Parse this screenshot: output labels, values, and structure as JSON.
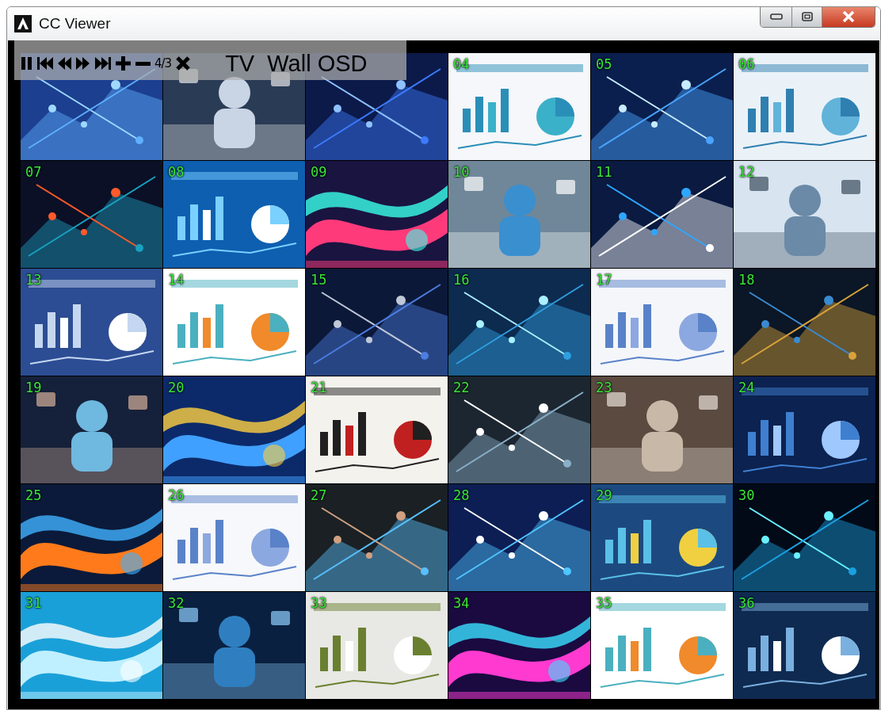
{
  "window": {
    "title": "CC Viewer"
  },
  "osd": {
    "controls": [
      {
        "kind": "pause"
      },
      {
        "kind": "first"
      },
      {
        "kind": "rewind"
      },
      {
        "kind": "forward"
      },
      {
        "kind": "last"
      },
      {
        "kind": "plus"
      },
      {
        "kind": "minus"
      },
      {
        "kind": "ratio",
        "text": "4/3"
      },
      {
        "kind": "close"
      }
    ],
    "title": "TV  Wall OSD"
  },
  "tiles": [
    {
      "kind": "picture"
    },
    {
      "kind": "picture"
    },
    {
      "kind": "picture"
    },
    {
      "kind": "picture",
      "label": "04"
    },
    {
      "kind": "picture",
      "label": "05"
    },
    {
      "kind": "picture",
      "label": "06"
    },
    {
      "kind": "picture",
      "label": "07"
    },
    {
      "kind": "picture",
      "label": "08"
    },
    {
      "kind": "picture",
      "label": "09"
    },
    {
      "kind": "picture",
      "label": "10"
    },
    {
      "kind": "picture",
      "label": "11"
    },
    {
      "kind": "picture",
      "label": "12"
    },
    {
      "kind": "picture",
      "label": "13"
    },
    {
      "kind": "picture",
      "label": "14"
    },
    {
      "kind": "picture",
      "label": "15"
    },
    {
      "kind": "picture",
      "label": "16"
    },
    {
      "kind": "picture",
      "label": "17"
    },
    {
      "kind": "picture",
      "label": "18"
    },
    {
      "kind": "picture",
      "label": "19"
    },
    {
      "kind": "picture",
      "label": "20"
    },
    {
      "kind": "picture",
      "label": "21"
    },
    {
      "kind": "picture",
      "label": "22"
    },
    {
      "kind": "picture",
      "label": "23"
    },
    {
      "kind": "picture",
      "label": "24"
    },
    {
      "kind": "picture",
      "label": "25"
    },
    {
      "kind": "picture",
      "label": "26"
    },
    {
      "kind": "picture",
      "label": "27"
    },
    {
      "kind": "picture",
      "label": "28"
    },
    {
      "kind": "picture",
      "label": "29"
    },
    {
      "kind": "picture",
      "label": "30"
    },
    {
      "kind": "picture",
      "label": "31"
    },
    {
      "kind": "picture",
      "label": "32"
    },
    {
      "kind": "picture",
      "label": "33"
    },
    {
      "kind": "picture",
      "label": "34"
    },
    {
      "kind": "picture",
      "label": "35"
    },
    {
      "kind": "picture",
      "label": "36"
    }
  ]
}
